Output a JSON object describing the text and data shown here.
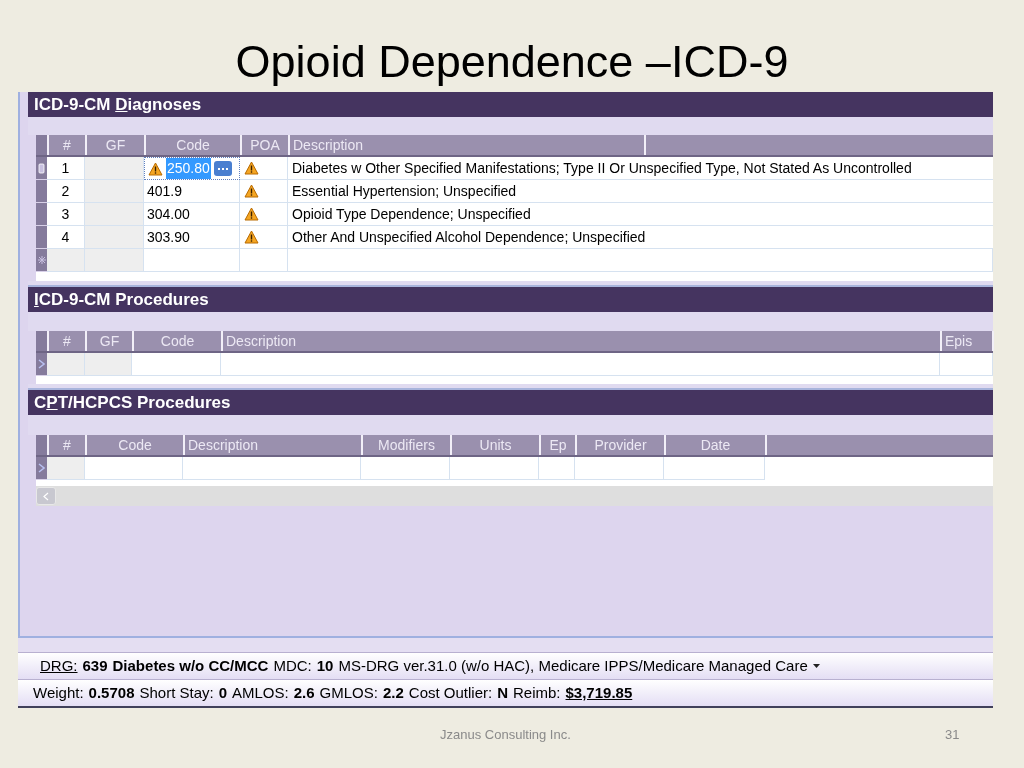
{
  "slide": {
    "title": "Opioid Dependence –ICD-9",
    "footer": "Jzanus Consulting Inc.",
    "page_number": "31"
  },
  "diagnoses": {
    "heading": {
      "before": "ICD-9-CM ",
      "mnemonic": "D",
      "after": "iagnoses"
    },
    "columns": [
      "#",
      "GF",
      "Code",
      "POA",
      "Description"
    ],
    "rows": [
      {
        "number": "1",
        "code": "250.80",
        "code_warning": true,
        "poa_warning": true,
        "description": "Diabetes w Other Specified Manifestations; Type II Or Unspecified Type, Not Stated As Uncontrolled",
        "selected": true
      },
      {
        "number": "2",
        "code": "401.9",
        "code_warning": false,
        "poa_warning": true,
        "description": "Essential Hypertension; Unspecified",
        "selected": false
      },
      {
        "number": "3",
        "code": "304.00",
        "code_warning": false,
        "poa_warning": true,
        "description": "Opioid Type Dependence; Unspecified",
        "selected": false
      },
      {
        "number": "4",
        "code": "303.90",
        "code_warning": false,
        "poa_warning": true,
        "description": "Other And Unspecified Alcohol Dependence; Unspecified",
        "selected": false
      }
    ]
  },
  "procedures": {
    "heading": {
      "mnemonic": "I",
      "after": "CD-9-CM Procedures"
    },
    "columns": [
      "#",
      "GF",
      "Code",
      "Description",
      "Epis"
    ]
  },
  "cpt": {
    "heading": {
      "before": "C",
      "mnemonic": "P",
      "after": "T/HCPCS Procedures"
    },
    "columns": [
      "#",
      "Code",
      "Description",
      "Modifiers",
      "Units",
      "Ep",
      "Provider",
      "Date"
    ]
  },
  "drg_line": [
    {
      "kind": "link_label",
      "text": "DRG:"
    },
    {
      "kind": "value",
      "text": "639"
    },
    {
      "kind": "value",
      "text": "Diabetes w/o CC/MCC"
    },
    {
      "kind": "label",
      "text": "MDC:"
    },
    {
      "kind": "value",
      "text": "10"
    },
    {
      "kind": "label",
      "text": "MS-DRG ver.31.0 (w/o HAC), Medicare IPPS/Medicare Managed Care"
    }
  ],
  "stats_line": [
    {
      "kind": "label",
      "text": "Weight:"
    },
    {
      "kind": "value",
      "text": "0.5708"
    },
    {
      "kind": "label",
      "text": "Short Stay:"
    },
    {
      "kind": "value",
      "text": "0"
    },
    {
      "kind": "label",
      "text": "AMLOS:"
    },
    {
      "kind": "value",
      "text": "2.6"
    },
    {
      "kind": "label",
      "text": "GMLOS:"
    },
    {
      "kind": "value",
      "text": "2.2"
    },
    {
      "kind": "label",
      "text": "Cost Outlier:"
    },
    {
      "kind": "value",
      "text": "N"
    },
    {
      "kind": "label",
      "text": "Reimb:"
    },
    {
      "kind": "link_value",
      "text": "$3,719.85"
    }
  ]
}
